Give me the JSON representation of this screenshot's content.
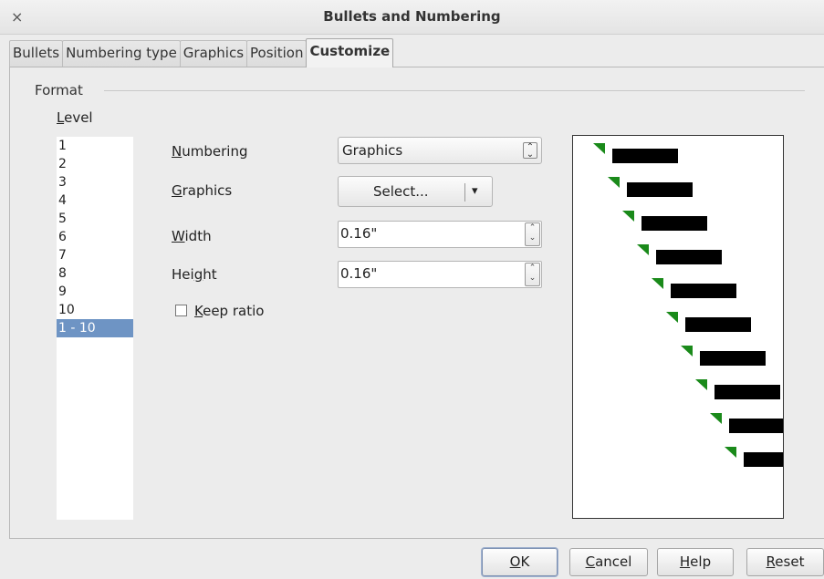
{
  "window": {
    "title": "Bullets and Numbering",
    "close_glyph": "×"
  },
  "tabs": [
    {
      "label": "Bullets"
    },
    {
      "label": "Numbering type"
    },
    {
      "label": "Graphics"
    },
    {
      "label": "Position"
    },
    {
      "label": "Customize",
      "active": true
    }
  ],
  "format": {
    "group_label": "Format",
    "level_label_u": "L",
    "level_label_rest": "evel",
    "levels": [
      "1",
      "2",
      "3",
      "4",
      "5",
      "6",
      "7",
      "8",
      "9",
      "10",
      "1 - 10"
    ],
    "selected_level": "1 - 10"
  },
  "fields": {
    "numbering": {
      "label_u": "N",
      "label_rest": "umbering",
      "value": "Graphics"
    },
    "graphics": {
      "label_u": "G",
      "label_rest": "raphics",
      "button": "Select...",
      "dropdown_glyph": "▾"
    },
    "width": {
      "label_u": "W",
      "label_rest": "idth",
      "value": "0.16\""
    },
    "height": {
      "label_pre": "Hei",
      "label_u": "g",
      "label_rest": "ht",
      "value": "0.16\""
    },
    "keep_ratio": {
      "label_u": "K",
      "label_rest": "eep ratio",
      "checked": false
    }
  },
  "preview": {
    "bullet_color": "#1a8a1a",
    "bar_color": "#000000",
    "count": 10
  },
  "buttons": {
    "ok": {
      "u": "O",
      "rest": "K"
    },
    "cancel": {
      "u": "C",
      "rest": "ancel"
    },
    "help": {
      "u": "H",
      "rest": "elp"
    },
    "reset": {
      "u": "R",
      "rest": "eset"
    }
  }
}
